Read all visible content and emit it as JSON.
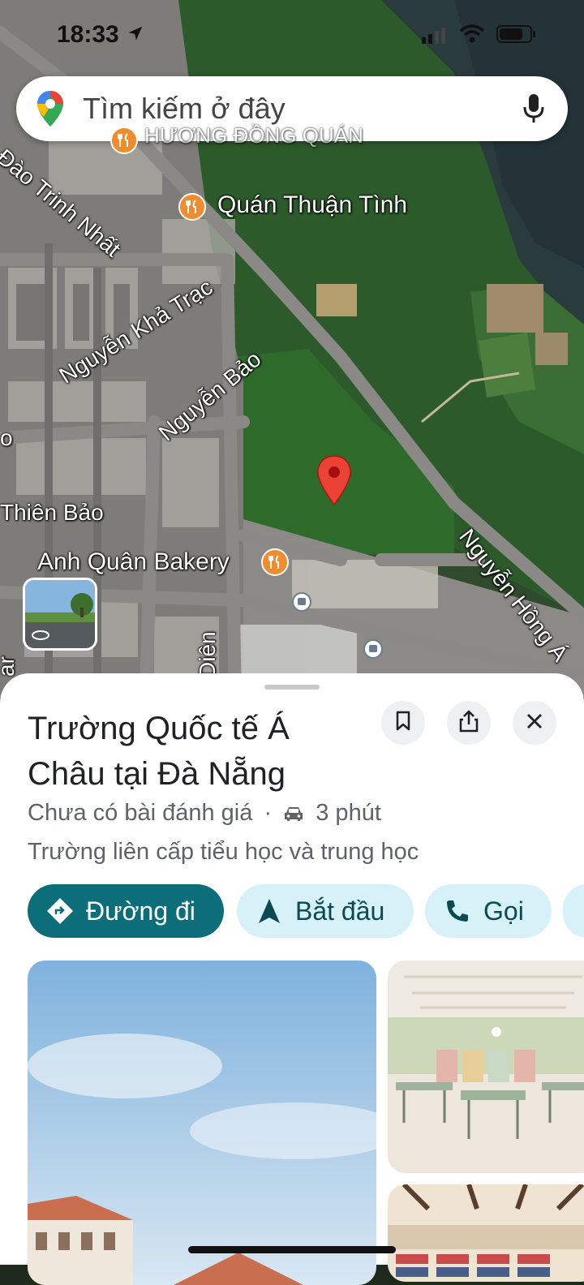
{
  "status_bar": {
    "time": "18:33"
  },
  "search": {
    "placeholder": "Tìm kiếm ở đây"
  },
  "map": {
    "pois": [
      "HƯƠNG ĐỒNG QUÁN",
      "Quán Thuận Tình",
      "Anh Quân Bakery"
    ],
    "streets": [
      "Đào Trinh Nhất",
      "Nguyễn Khả Trạc",
      "Nguyễn Bảo",
      "Thiên Bảo",
      "Nguyễn Hồng Á",
      "Diên",
      "ar",
      "o"
    ]
  },
  "place": {
    "title": "Trường Quốc tế Á Châu tại Đà Nẵng",
    "rating": "Chưa có bài đánh giá",
    "separator": "·",
    "travel_time": "3 phút",
    "category": "Trường liên cấp tiểu học và trung học"
  },
  "actions": {
    "directions": "Đường đi",
    "start": "Bắt đầu",
    "call": "Gọi"
  },
  "colors": {
    "primary": "#0b6e78",
    "chip_bg": "#d6f1f8",
    "pin": "#ea4335",
    "poi": "#f08b2e"
  },
  "icons": [
    "location-pin-icon",
    "mic-icon",
    "bookmark-icon",
    "share-icon",
    "close-icon",
    "car-icon",
    "directions-icon",
    "navigation-arrow-icon",
    "phone-icon"
  ]
}
